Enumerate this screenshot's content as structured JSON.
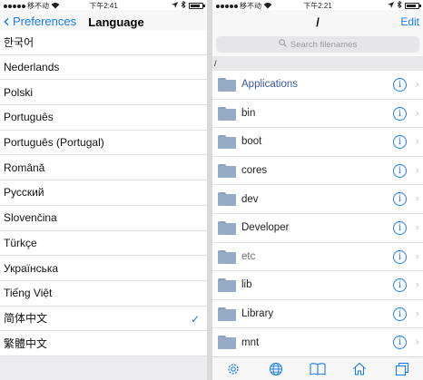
{
  "left_status": {
    "carrier": "移不动",
    "time": "下午2:41"
  },
  "right_status": {
    "carrier": "移不动",
    "time": "下午2:21"
  },
  "left_nav": {
    "back_label": "Preferences",
    "title": "Language"
  },
  "languages": [
    {
      "label": "한국어",
      "checked": false
    },
    {
      "label": "Nederlands",
      "checked": false
    },
    {
      "label": "Polski",
      "checked": false
    },
    {
      "label": "Português",
      "checked": false
    },
    {
      "label": "Português (Portugal)",
      "checked": false
    },
    {
      "label": "Română",
      "checked": false
    },
    {
      "label": "Русский",
      "checked": false
    },
    {
      "label": "Slovenčina",
      "checked": false
    },
    {
      "label": "Türkçe",
      "checked": false
    },
    {
      "label": "Українська",
      "checked": false
    },
    {
      "label": "Tiếng Việt",
      "checked": false
    },
    {
      "label": "简体中文",
      "checked": true
    },
    {
      "label": "繁體中文",
      "checked": false
    }
  ],
  "checkmark": "✓",
  "right_nav": {
    "title": "/",
    "edit_label": "Edit"
  },
  "search": {
    "placeholder": "Search filenames"
  },
  "path": "/",
  "files": [
    {
      "name": "Applications",
      "style": "accent"
    },
    {
      "name": "bin",
      "style": "normal"
    },
    {
      "name": "boot",
      "style": "normal"
    },
    {
      "name": "cores",
      "style": "normal"
    },
    {
      "name": "dev",
      "style": "normal"
    },
    {
      "name": "Developer",
      "style": "normal"
    },
    {
      "name": "etc",
      "style": "muted"
    },
    {
      "name": "lib",
      "style": "normal"
    },
    {
      "name": "Library",
      "style": "normal"
    },
    {
      "name": "mnt",
      "style": "normal"
    }
  ],
  "icons": {
    "back": "chevron-left-icon",
    "folder": "folder-icon",
    "info": "info-icon",
    "disclosure": "chevron-right-icon",
    "tabs": [
      "gear-icon",
      "globe-icon",
      "book-icon",
      "home-icon",
      "windows-icon"
    ]
  },
  "colors": {
    "accent": "#1a7cf6",
    "folder": "#95abc6",
    "highlight_text": "#3c55a3"
  }
}
